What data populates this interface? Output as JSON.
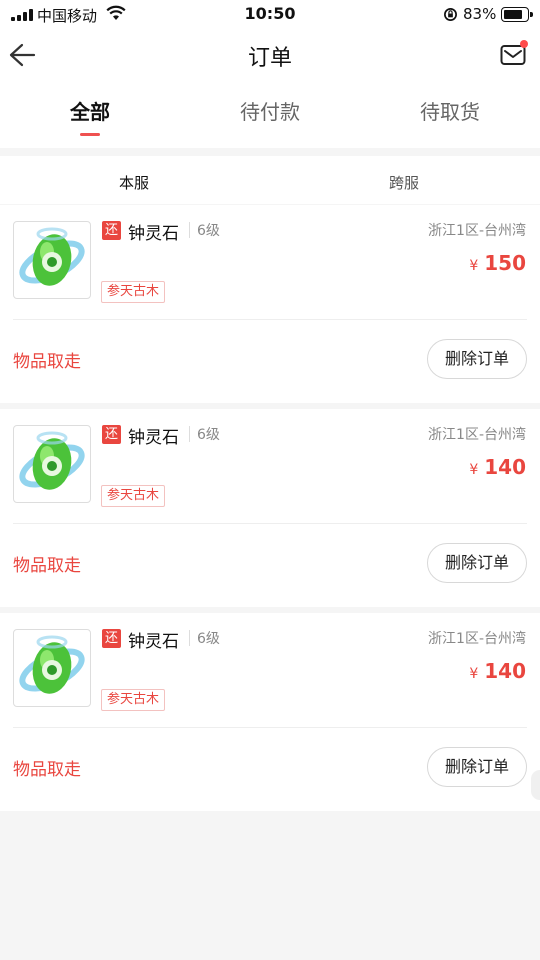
{
  "status_bar": {
    "carrier": "中国移动",
    "time": "10:50",
    "battery": "83%",
    "battery_level": 0.83
  },
  "nav": {
    "title": "订单"
  },
  "tabs": [
    {
      "label": "全部",
      "active": true
    },
    {
      "label": "待付款",
      "active": false
    },
    {
      "label": "待取货",
      "active": false
    }
  ],
  "server_filter": {
    "options": [
      {
        "label": "本服",
        "active": true
      },
      {
        "label": "跨服",
        "active": false
      }
    ]
  },
  "orders": [
    {
      "badge": "还",
      "name": "钟灵石",
      "level": "6级",
      "region": "浙江1区-台州湾",
      "currency": "¥",
      "price": "150",
      "tag": "参天古木",
      "status": "物品取走",
      "delete_label": "删除订单"
    },
    {
      "badge": "还",
      "name": "钟灵石",
      "level": "6级",
      "region": "浙江1区-台州湾",
      "currency": "¥",
      "price": "140",
      "tag": "参天古木",
      "status": "物品取走",
      "delete_label": "删除订单"
    },
    {
      "badge": "还",
      "name": "钟灵石",
      "level": "6级",
      "region": "浙江1区-台州湾",
      "currency": "¥",
      "price": "140",
      "tag": "参天古木",
      "status": "物品取走",
      "delete_label": "删除订单"
    }
  ],
  "colors": {
    "accent": "#e9463f",
    "background": "#f5f5f5"
  }
}
